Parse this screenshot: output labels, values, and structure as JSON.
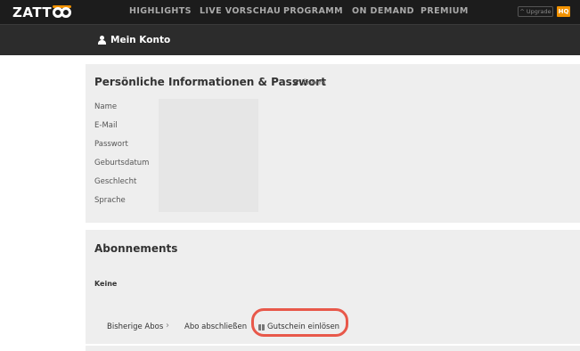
{
  "brand": {
    "logo_text": "ZATT",
    "accent": "#f29200"
  },
  "nav": {
    "items": [
      "HIGHLIGHTS",
      "LIVE VORSCHAU",
      "PROGRAMM",
      "ON DEMAND",
      "PREMIUM"
    ],
    "upgrade_label": "Upgrade",
    "hq_label": "HQ"
  },
  "account": {
    "title": "Mein Konto",
    "icon": "user-icon"
  },
  "personal": {
    "title": "Persönliche Informationen & Passwort",
    "edit_label": "Ändern",
    "fields": [
      "Name",
      "E-Mail",
      "Passwort",
      "Geburtsdatum",
      "Geschlecht",
      "Sprache"
    ]
  },
  "subscriptions": {
    "title": "Abonnements",
    "none_label": "Keine",
    "history_label": "Bisherige Abos",
    "subscribe_label": "Abo abschließen",
    "voucher_label": "Gutschein einlösen",
    "highlight_color": "#e8584a"
  }
}
